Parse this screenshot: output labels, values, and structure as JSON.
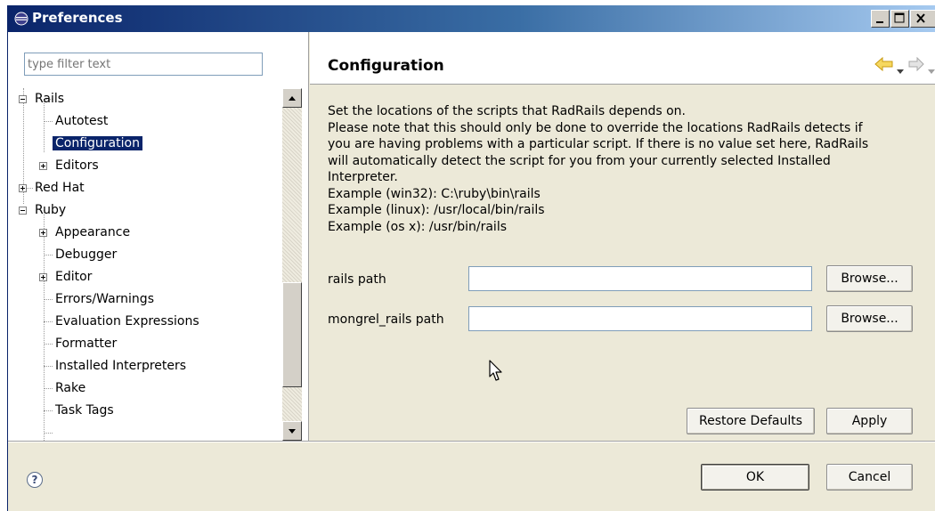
{
  "window": {
    "title": "Preferences"
  },
  "left": {
    "filter_placeholder": "type filter text",
    "tree": {
      "rails": "Rails",
      "autotest": "Autotest",
      "configuration": "Configuration",
      "editors": "Editors",
      "red_hat": "Red Hat",
      "ruby": "Ruby",
      "appearance": "Appearance",
      "debugger": "Debugger",
      "editor": "Editor",
      "errors_warnings": "Errors/Warnings",
      "evaluation_expressions": "Evaluation Expressions",
      "formatter": "Formatter",
      "installed_interpreters": "Installed Interpreters",
      "rake": "Rake",
      "task_tags": "Task Tags"
    },
    "selected": "Configuration"
  },
  "page": {
    "title": "Configuration",
    "description": [
      "Set the locations of the scripts that RadRails depends on.",
      "Please note that this should only be done to override the locations RadRails detects if",
      "you are having problems with a particular script. If there is no value set here, RadRails",
      "will automatically detect the script for you from your currently selected Installed",
      "Interpreter.",
      "Example (win32): C:\\ruby\\bin\\rails",
      "Example (linux): /usr/local/bin/rails",
      "Example (os x): /usr/bin/rails"
    ],
    "rails_path_label": "rails path",
    "rails_path_value": "",
    "mongrel_path_label": "mongrel_rails path",
    "mongrel_path_value": "",
    "browse_label": "Browse...",
    "restore_defaults_label": "Restore Defaults",
    "apply_label": "Apply"
  },
  "footer": {
    "help_glyph": "?",
    "ok_label": "OK",
    "cancel_label": "Cancel"
  },
  "colors": {
    "title_bar": "#0a246a",
    "selection": "#0a246a",
    "nav_arrow": "#e8b830",
    "dialog_bg": "#ece9d8"
  }
}
